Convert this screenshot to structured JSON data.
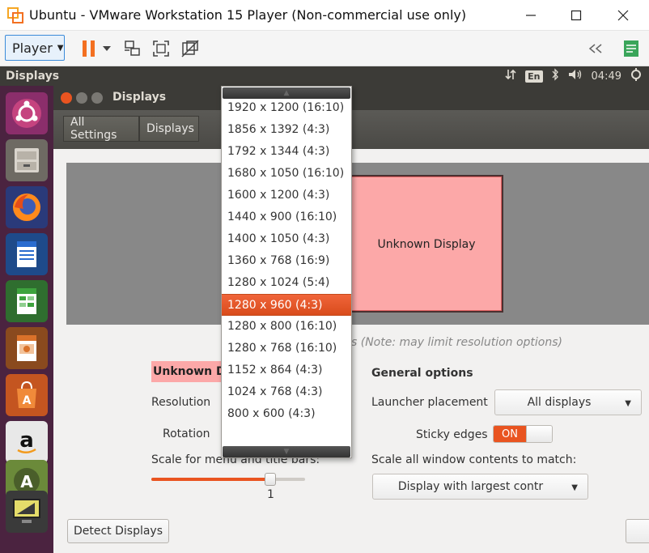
{
  "window": {
    "title": "Ubuntu - VMware Workstation 15 Player (Non-commercial use only)",
    "controls": [
      "minimize-icon",
      "maximize-icon",
      "close-icon"
    ]
  },
  "toolbar": {
    "player_label": "Player",
    "icons": [
      "pause-icon",
      "send-keys-icon",
      "fullscreen-icon",
      "unity-icon",
      "back-arrows-icon",
      "notes-icon"
    ]
  },
  "ubuntu_panel": {
    "title": "Displays",
    "lang": "En",
    "time": "04:49"
  },
  "launcher": {
    "items": [
      "ubuntu-dash",
      "files",
      "firefox",
      "writer",
      "calc",
      "impress",
      "software-center",
      "amazon",
      "updater",
      "displays-app"
    ]
  },
  "settings": {
    "title": "Displays",
    "nav": {
      "all_settings": "All Settings",
      "displays": "Displays"
    },
    "display_box_label": "Unknown Display",
    "note": "s (Note: may limit resolution options)",
    "unknown_heading": "Unknown Display",
    "resolution_label": "Resolution",
    "rotation_label": "Rotation",
    "scale_label": "Scale for menu and title bars:",
    "scale_value": "1",
    "scale_fraction": 0.77,
    "general_heading": "General options",
    "launcher_placement_label": "Launcher placement",
    "launcher_placement_value": "All displays",
    "sticky_edges_label": "Sticky edges",
    "sticky_edges_state": "ON",
    "scale_all_label": "Scale all window contents to match:",
    "scale_all_value": "Display with largest contr",
    "detect_button": "Detect Displays"
  },
  "resolution_menu": {
    "selected_index": 9,
    "options": [
      "1920 x 1200 (16:10)",
      "1856 x 1392 (4:3)",
      "1792 x 1344 (4:3)",
      "1680 x 1050 (16:10)",
      "1600 x 1200 (4:3)",
      "1440 x 900 (16:10)",
      "1400 x 1050 (4:3)",
      "1360 x 768 (16:9)",
      "1280 x 1024 (5:4)",
      "1280 x 960 (4:3)",
      "1280 x 800 (16:10)",
      "1280 x 768 (16:10)",
      "1152 x 864 (4:3)",
      "1024 x 768 (4:3)",
      "800 x 600 (4:3)"
    ]
  },
  "colors": {
    "accent": "#e95420",
    "panel": "#3c3b37",
    "launcher": "#4b2340",
    "display_fill": "#fca8a8",
    "vmware_orange": "#f37021"
  }
}
